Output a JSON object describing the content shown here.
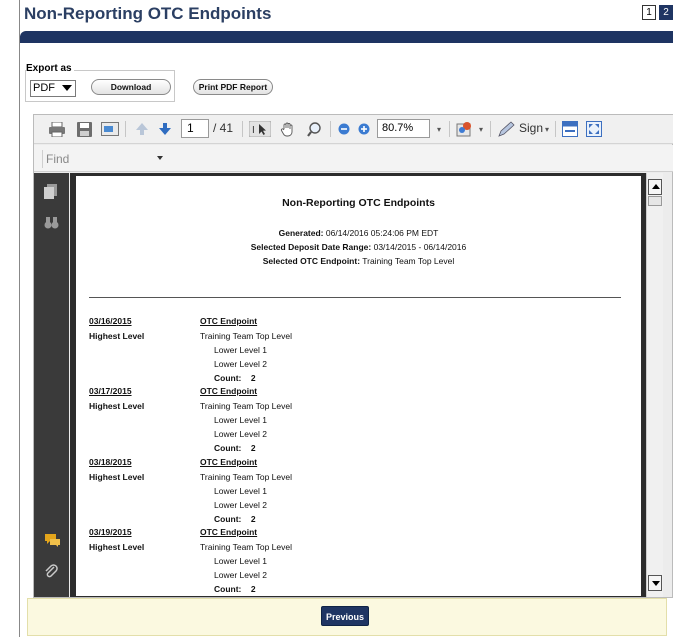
{
  "header": {
    "title": "Non-Reporting OTC Endpoints",
    "pages": [
      "1",
      "2"
    ]
  },
  "export": {
    "legend": "Export as",
    "format": "PDF",
    "download_label": "Download",
    "print_label": "Print PDF Report"
  },
  "viewer": {
    "current_page": "1",
    "total_pages": "/ 41",
    "zoom": "80.7%",
    "sign_label": "Sign",
    "find_placeholder": "Find"
  },
  "report": {
    "title": "Non-Reporting OTC Endpoints",
    "generated_label": "Generated:",
    "generated_value": "06/14/2016 05:24:06 PM EDT",
    "range_label": "Selected Deposit Date Range:",
    "range_value": "03/14/2015 - 06/14/2016",
    "endpoint_label": "Selected OTC Endpoint:",
    "endpoint_value": "Training Team Top Level",
    "groups": [
      {
        "date": "03/16/2015",
        "level_label": "Highest Level",
        "col_header": "OTC Endpoint",
        "top": "Training Team Top Level",
        "l1": "Lower Level 1",
        "l2": "Lower Level 2",
        "count_label": "Count:",
        "count": "2"
      },
      {
        "date": "03/17/2015",
        "level_label": "Highest Level",
        "col_header": "OTC Endpoint",
        "top": "Training Team Top Level",
        "l1": "Lower Level 1",
        "l2": "Lower Level 2",
        "count_label": "Count:",
        "count": "2"
      },
      {
        "date": "03/18/2015",
        "level_label": "Highest Level",
        "col_header": "OTC Endpoint",
        "top": "Training Team Top Level",
        "l1": "Lower Level 1",
        "l2": "Lower Level 2",
        "count_label": "Count:",
        "count": "2"
      },
      {
        "date": "03/19/2015",
        "level_label": "Highest Level",
        "col_header": "OTC Endpoint",
        "top": "Training Team Top Level",
        "l1": "Lower Level 1",
        "l2": "Lower Level 2",
        "count_label": "Count:",
        "count": "2"
      }
    ]
  },
  "footer": {
    "previous_label": "Previous"
  }
}
